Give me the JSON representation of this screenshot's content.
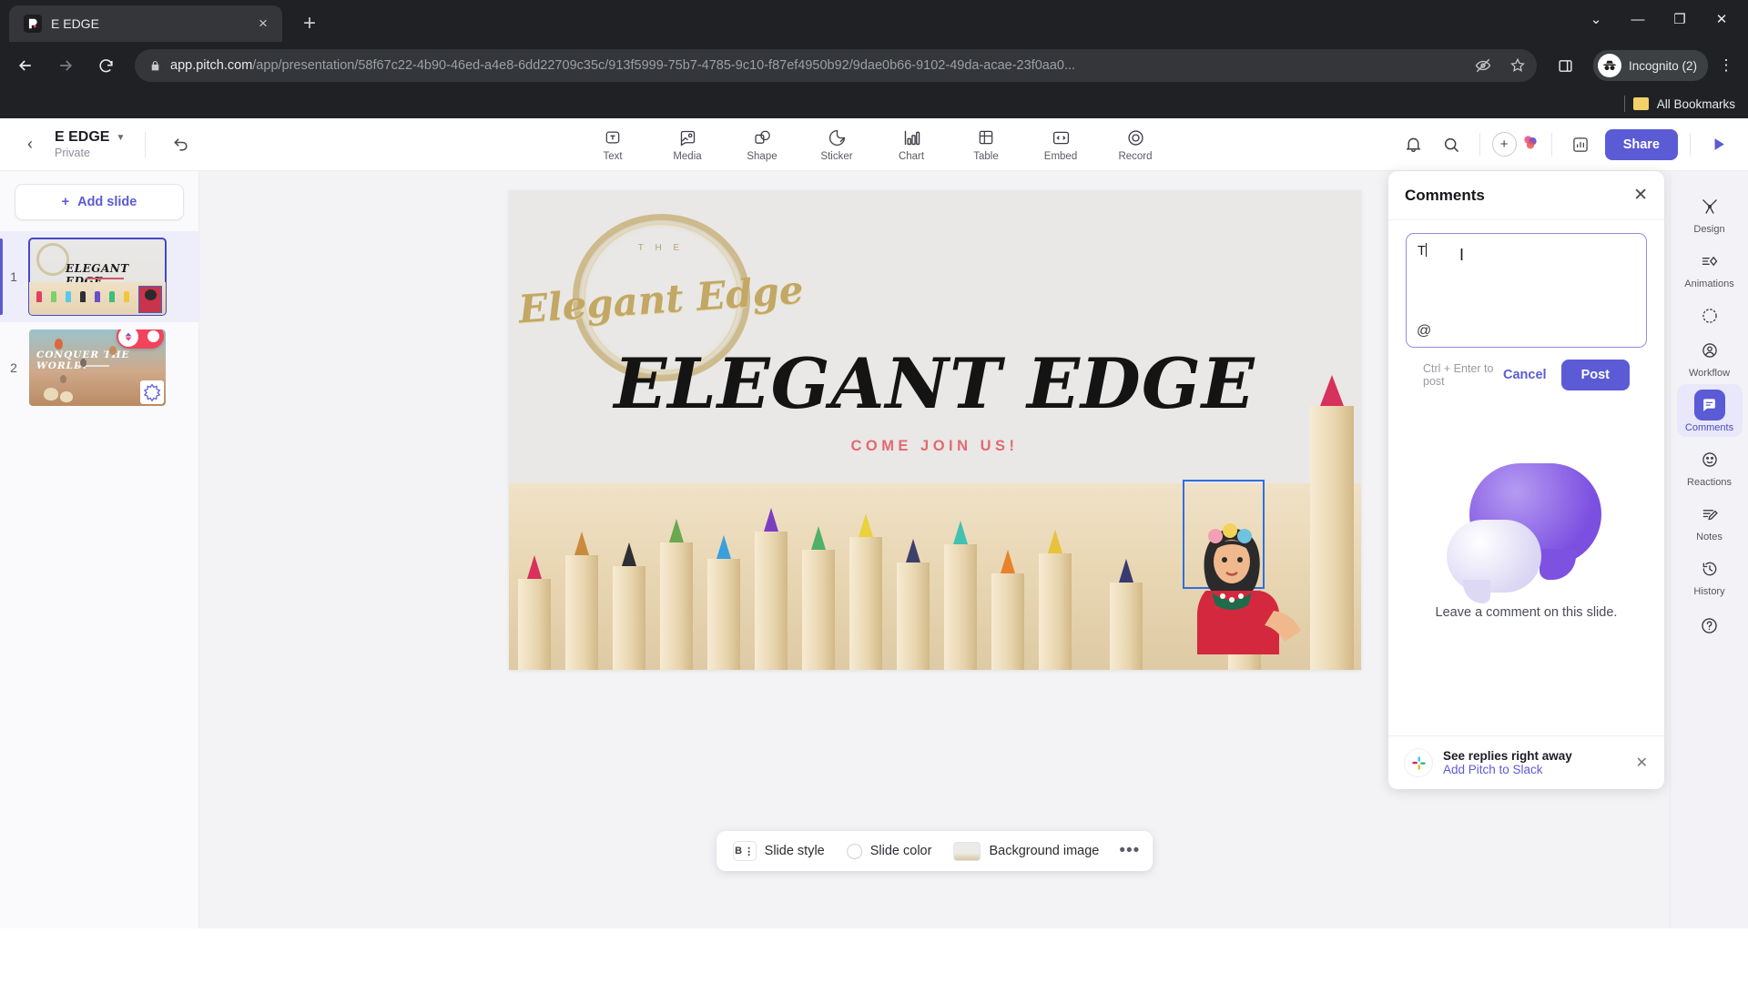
{
  "browser": {
    "tab": {
      "title": "E EDGE",
      "favicon": "pitch-logo-icon",
      "close_label": "×"
    },
    "new_tab_label": "+",
    "window_controls": {
      "minimize": "—",
      "maximize": "❐",
      "close": "✕",
      "chevron": "⌄"
    },
    "nav": {
      "back": "←",
      "forward": "→",
      "reload": "↻"
    },
    "url": {
      "domain": "app.pitch.com",
      "path": "/app/presentation/58f67c22-4b90-46ed-a4e8-6dd22709c35c/913f5999-75b7-4785-9c10-f87ef4950b92/9dae0b66-9102-49da-acae-23f0aa0...",
      "lock_icon": "lock-icon"
    },
    "profile": {
      "label": "Incognito (2)"
    },
    "bookmarks": {
      "label": "All Bookmarks"
    }
  },
  "app_header": {
    "back_label": "‹",
    "deck_title": "E EDGE",
    "deck_visibility": "Private",
    "undo_label": "undo-icon",
    "insert_tools": [
      {
        "label": "Text",
        "icon": "text-icon"
      },
      {
        "label": "Media",
        "icon": "media-icon"
      },
      {
        "label": "Shape",
        "icon": "shape-icon"
      },
      {
        "label": "Sticker",
        "icon": "sticker-icon"
      },
      {
        "label": "Chart",
        "icon": "chart-icon"
      },
      {
        "label": "Table",
        "icon": "table-icon"
      },
      {
        "label": "Embed",
        "icon": "embed-icon"
      },
      {
        "label": "Record",
        "icon": "record-icon"
      }
    ],
    "share_label": "Share"
  },
  "slides_panel": {
    "add_slide_label": "Add slide",
    "add_slide_plus": "+",
    "slides": [
      {
        "number": "1",
        "title": "ELEGANT EDGE",
        "active": true
      },
      {
        "number": "2",
        "title": "CONQUER THE WORLD!",
        "active": false
      }
    ]
  },
  "slide": {
    "wreath_kicker": "T H E",
    "wreath_script": "Elegant Edge",
    "title": "ELEGANT EDGE",
    "subtitle": "COME JOIN US!"
  },
  "slide_toolbar": {
    "style_label": "Slide style",
    "style_icon_text": "B",
    "color_label": "Slide color",
    "background_label": "Background image",
    "more_label": "•••"
  },
  "comments": {
    "title": "Comments",
    "close_label": "✕",
    "draft_text": "T",
    "mention_icon": "at-icon",
    "hint": "Ctrl + Enter to post",
    "cancel_label": "Cancel",
    "post_label": "Post",
    "empty_text": "Leave a comment on this slide.",
    "slack": {
      "title": "See replies right away",
      "link": "Add Pitch to Slack",
      "close_label": "✕",
      "icon": "slack-icon"
    }
  },
  "right_rail": {
    "items": [
      {
        "label": "Design",
        "icon": "design-icon",
        "active": false
      },
      {
        "label": "Animations",
        "icon": "animations-icon",
        "active": false
      },
      {
        "label": "Workflow",
        "icon": "workflow-icon",
        "active": false
      },
      {
        "label": "Comments",
        "icon": "comments-icon",
        "active": true
      },
      {
        "label": "Reactions",
        "icon": "reactions-icon",
        "active": false
      },
      {
        "label": "Notes",
        "icon": "notes-icon",
        "active": false
      },
      {
        "label": "History",
        "icon": "history-icon",
        "active": false
      }
    ],
    "help_label": "?"
  },
  "colors": {
    "accent": "#5b5bd6",
    "browser_chrome": "#202124",
    "slide_bg": "#e9e8e6",
    "subtitle": "#e26a72",
    "gold": "#c2a864"
  }
}
